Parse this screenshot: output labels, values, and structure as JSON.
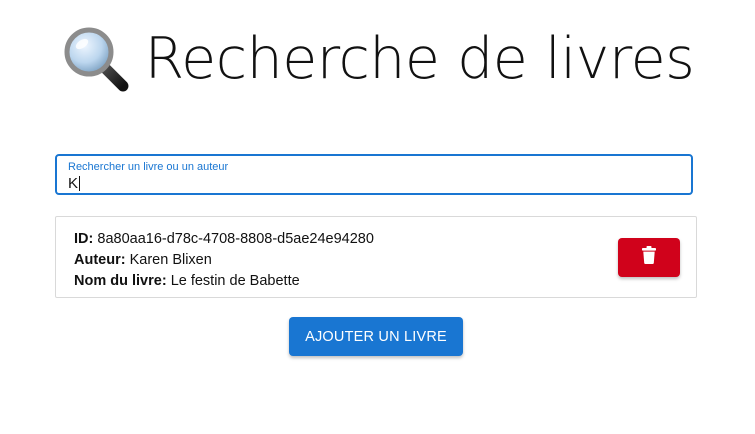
{
  "header": {
    "icon": "magnifying-glass-icon",
    "title": "Recherche de livres"
  },
  "search": {
    "label": "Rechercher un livre ou un auteur",
    "value": "K"
  },
  "books": [
    {
      "id_label": "ID:",
      "id": "8a80aa16-d78c-4708-8808-d5ae24e94280",
      "author_label": "Auteur:",
      "author": "Karen Blixen",
      "name_label": "Nom du livre:",
      "name": "Le festin de Babette",
      "delete_icon": "trash-icon"
    }
  ],
  "actions": {
    "add_label": "AJOUTER UN LIVRE"
  },
  "colors": {
    "primary": "#1976d2",
    "danger": "#d0021b",
    "border": "#d9d9d9"
  }
}
